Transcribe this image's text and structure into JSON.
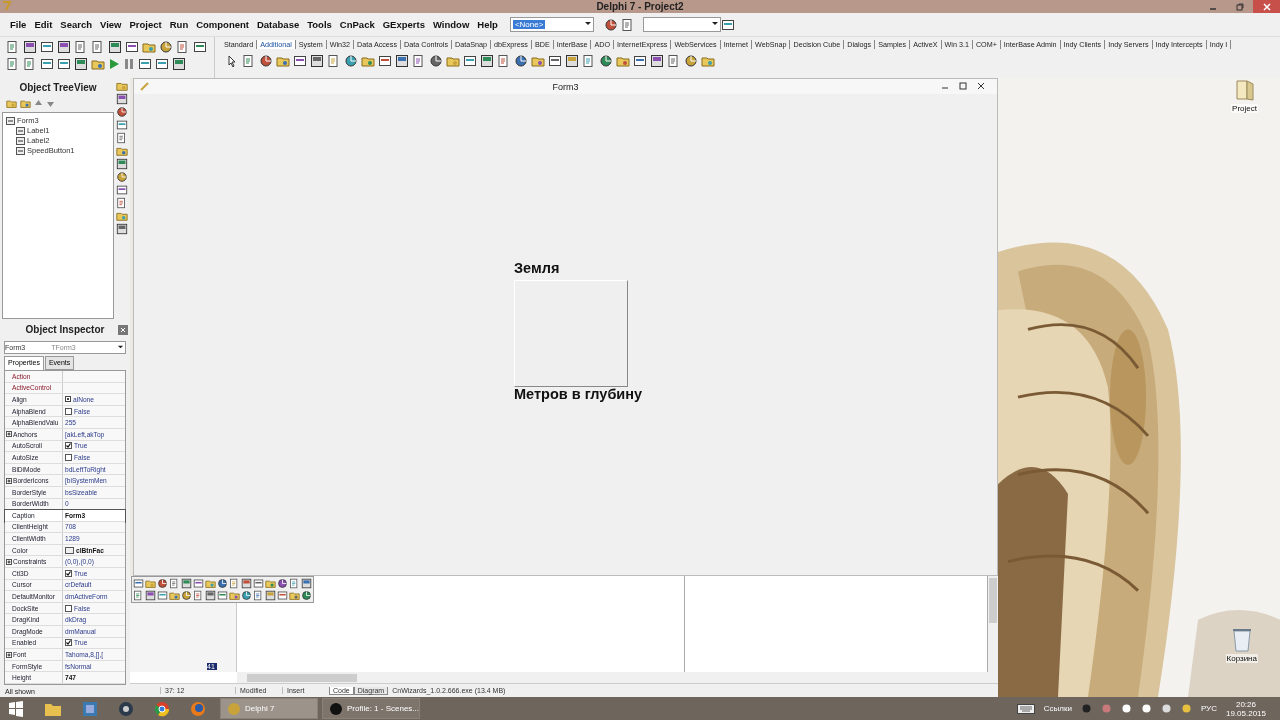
{
  "window": {
    "title": "Delphi 7 - Project2"
  },
  "menu": [
    "File",
    "Edit",
    "Search",
    "View",
    "Project",
    "Run",
    "Component",
    "Database",
    "Tools",
    "CnPack",
    "GExperts",
    "Window",
    "Help"
  ],
  "component_combo": {
    "value": "<None>"
  },
  "palette_tabs": [
    {
      "label": "Standard",
      "selected": false
    },
    {
      "label": "Additional",
      "selected": true
    },
    {
      "label": "System",
      "selected": false
    },
    {
      "label": "Win32",
      "selected": false
    },
    {
      "label": "Data Access",
      "selected": false
    },
    {
      "label": "Data Controls",
      "selected": false
    },
    {
      "label": "DataSnap",
      "selected": false
    },
    {
      "label": "dbExpress",
      "selected": false
    },
    {
      "label": "BDE",
      "selected": false
    },
    {
      "label": "InterBase",
      "selected": false
    },
    {
      "label": "ADO",
      "selected": false
    },
    {
      "label": "InternetExpress",
      "selected": false
    },
    {
      "label": "WebServices",
      "selected": false
    },
    {
      "label": "Internet",
      "selected": false
    },
    {
      "label": "WebSnap",
      "selected": false
    },
    {
      "label": "Decision Cube",
      "selected": false
    },
    {
      "label": "Dialogs",
      "selected": false
    },
    {
      "label": "Samples",
      "selected": false
    },
    {
      "label": "ActiveX",
      "selected": false
    },
    {
      "label": "Win 3.1",
      "selected": false
    },
    {
      "label": "COM+",
      "selected": false
    },
    {
      "label": "InterBase Admin",
      "selected": false
    },
    {
      "label": "Indy Clients",
      "selected": false
    },
    {
      "label": "Indy Servers",
      "selected": false
    },
    {
      "label": "Indy Intercepts",
      "selected": false
    },
    {
      "label": "Indy I",
      "selected": false
    }
  ],
  "tree_view": {
    "title": "Object TreeView",
    "items": [
      {
        "label": "Form3",
        "children": [
          {
            "label": "Label1"
          },
          {
            "label": "Label2"
          },
          {
            "label": "SpeedButton1"
          }
        ]
      }
    ]
  },
  "inspector": {
    "title": "Object Inspector",
    "object": "Form3",
    "type": "TForm3",
    "tabs": [
      {
        "label": "Properties",
        "selected": true
      },
      {
        "label": "Events",
        "selected": false
      }
    ],
    "properties": [
      {
        "name": "Action",
        "kind": "link",
        "selected": false
      },
      {
        "name": "ActiveControl",
        "kind": "link",
        "selected": false
      },
      {
        "name": "Align",
        "kind": "enum",
        "value": "alNone",
        "selected": false,
        "modified": false
      },
      {
        "name": "AlphaBlend",
        "kind": "check",
        "value": "False",
        "checked": false,
        "selected": false,
        "modified": false
      },
      {
        "name": "AlphaBlendValu",
        "kind": "plain",
        "value": "255",
        "selected": false,
        "modified": false
      },
      {
        "name": "Anchors",
        "kind": "expand",
        "value": "[akLeft,akTop",
        "selected": false,
        "modified": false
      },
      {
        "name": "AutoScroll",
        "kind": "check",
        "value": "True",
        "checked": true,
        "selected": false,
        "modified": false
      },
      {
        "name": "AutoSize",
        "kind": "check",
        "value": "False",
        "checked": false,
        "selected": false,
        "modified": false
      },
      {
        "name": "BiDiMode",
        "kind": "plain",
        "value": "bdLeftToRight",
        "selected": false,
        "modified": false
      },
      {
        "name": "BorderIcons",
        "kind": "expand",
        "value": "[biSystemMen",
        "selected": false,
        "modified": false
      },
      {
        "name": "BorderStyle",
        "kind": "plain",
        "value": "bsSizeable",
        "selected": false,
        "modified": false
      },
      {
        "name": "BorderWidth",
        "kind": "plain",
        "value": "0",
        "selected": false,
        "modified": false
      },
      {
        "name": "Caption",
        "kind": "plain",
        "value": "Form3",
        "selected": true,
        "modified": true
      },
      {
        "name": "ClientHeight",
        "kind": "plain",
        "value": "708",
        "selected": false,
        "modified": false
      },
      {
        "name": "ClientWidth",
        "kind": "plain",
        "value": "1289",
        "selected": false,
        "modified": false
      },
      {
        "name": "Color",
        "kind": "color",
        "value": "clBtnFac",
        "selected": false,
        "modified": true
      },
      {
        "name": "Constraints",
        "kind": "expand",
        "value": "(0,0),(0,0)",
        "selected": false,
        "modified": false
      },
      {
        "name": "Ctl3D",
        "kind": "check",
        "value": "True",
        "checked": true,
        "selected": false,
        "modified": false
      },
      {
        "name": "Cursor",
        "kind": "plain",
        "value": "crDefault",
        "selected": false,
        "modified": false
      },
      {
        "name": "DefaultMonitor",
        "kind": "plain",
        "value": "dmActiveForm",
        "selected": false,
        "modified": false
      },
      {
        "name": "DockSite",
        "kind": "check",
        "value": "False",
        "checked": false,
        "selected": false,
        "modified": false
      },
      {
        "name": "DragKind",
        "kind": "plain",
        "value": "dkDrag",
        "selected": false,
        "modified": false
      },
      {
        "name": "DragMode",
        "kind": "plain",
        "value": "dmManual",
        "selected": false,
        "modified": false
      },
      {
        "name": "Enabled",
        "kind": "check",
        "value": "True",
        "checked": true,
        "selected": false,
        "modified": false
      },
      {
        "name": "Font",
        "kind": "expand",
        "value": "Tahoma,8,[],[",
        "selected": false,
        "modified": false
      },
      {
        "name": "FormStyle",
        "kind": "plain",
        "value": "fsNormal",
        "selected": false,
        "modified": false
      },
      {
        "name": "Height",
        "kind": "plain",
        "value": "747",
        "selected": false,
        "modified": true
      }
    ],
    "footer": "All shown"
  },
  "form": {
    "title": "Form3",
    "labels": [
      "Земля",
      "Метров в глубину"
    ]
  },
  "editor": {
    "line": "41",
    "position": "37: 12",
    "modified": "Modified",
    "mode": "Insert",
    "tabs": [
      {
        "label": "Code",
        "selected": true
      },
      {
        "label": "Diagram",
        "selected": false
      }
    ],
    "status": "CnWizards_1.0.2.666.exe (13.4 MB)"
  },
  "desktop_icons": [
    {
      "label": "Project"
    },
    {
      "label": "Корзина"
    }
  ],
  "taskbar": {
    "buttons": [
      {
        "label": "Delphi 7",
        "selected": true
      },
      {
        "label": "Profile: 1 - Scenes...",
        "selected": false
      }
    ],
    "tray_label": "Ссылки",
    "language": "РУС",
    "time": "20:26",
    "date": "19.05.2015"
  }
}
